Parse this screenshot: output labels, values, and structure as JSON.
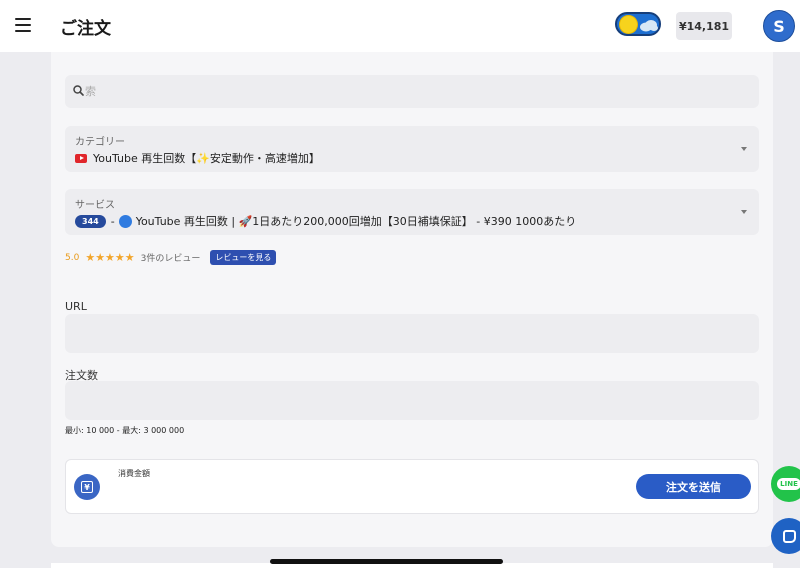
{
  "header": {
    "title": "ご注文",
    "balance": "¥14,181",
    "avatar_initial": "S"
  },
  "search": {
    "placeholder": "索"
  },
  "category": {
    "label": "カテゴリー",
    "value": "YouTube 再生回数【✨安定動作・高速増加】"
  },
  "service": {
    "label": "サービス",
    "id_badge": "344",
    "prefix": "-",
    "value": "YouTube 再生回数 | 🚀1日あたり200,000回増加【30日補填保証】 - ¥390 1000あたり"
  },
  "rating": {
    "score": "5.0",
    "stars": "★★★★★",
    "stars_value": 5,
    "review_count": "3件のレビュー",
    "review_button": "レビューを見る"
  },
  "url_field": {
    "label": "URL",
    "value": ""
  },
  "quantity_field": {
    "label": "注文数",
    "value": "",
    "minmax": "最小: 10 000 - 最大: 3 000 000"
  },
  "total": {
    "label": "消費金額",
    "submit_label": "注文を送信"
  },
  "floating": {
    "line_label": "LINE"
  },
  "colors": {
    "primary": "#2a5cc6",
    "star": "#f2a52b",
    "line": "#22c34a"
  }
}
